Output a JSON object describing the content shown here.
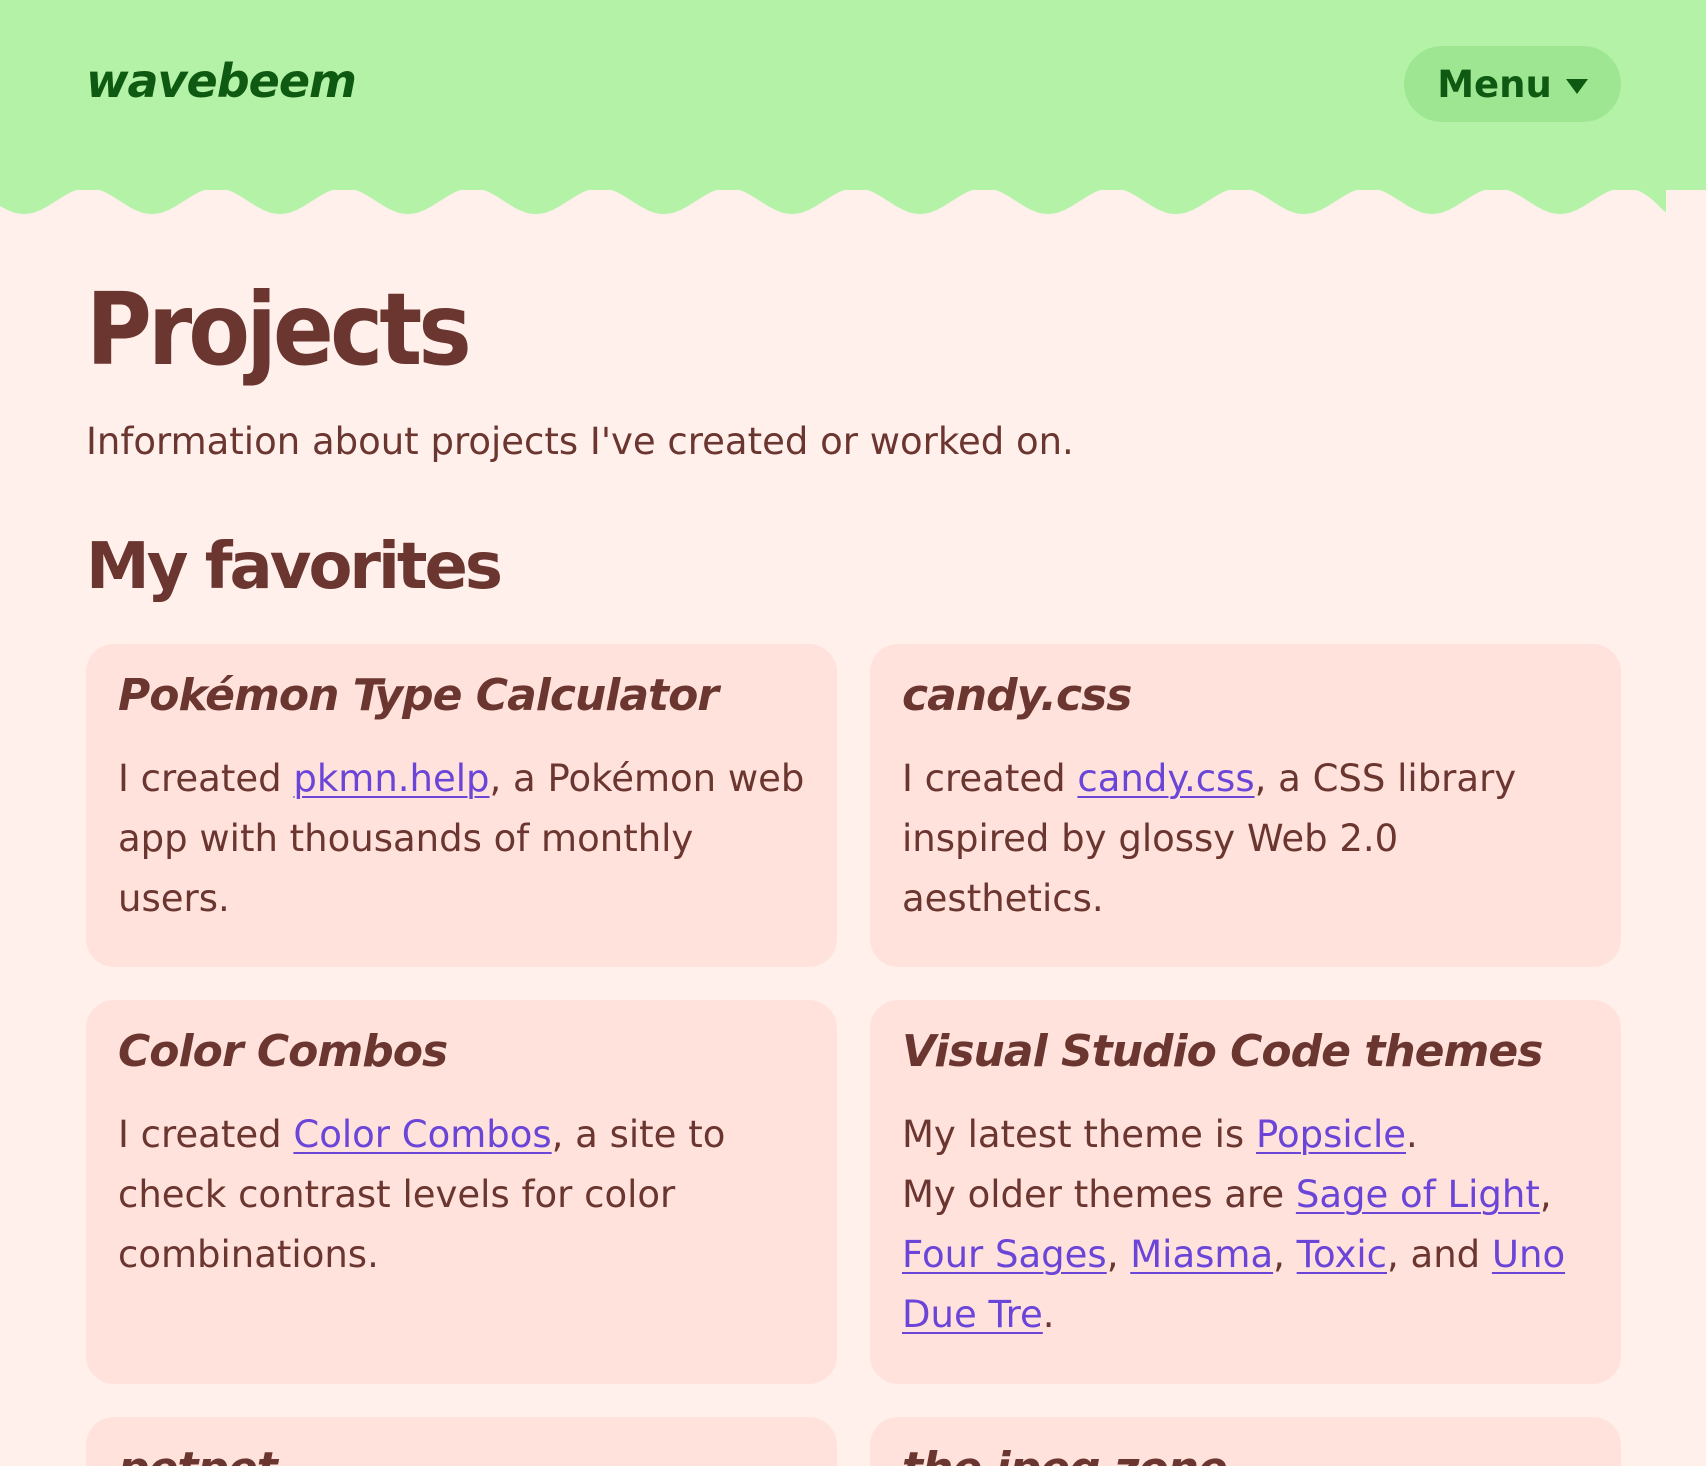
{
  "header": {
    "logo": "wavebeem",
    "menu_label": "Menu"
  },
  "page": {
    "title": "Projects",
    "intro": "Information about projects I've created or worked on.",
    "section_title": "My favorites"
  },
  "cards": [
    {
      "title": "Pokémon Type Calculator",
      "pre": "I created ",
      "link": "pkmn.help",
      "post": ", a Pokémon web app with thousands of monthly users."
    },
    {
      "title": "candy.css",
      "pre": "I created ",
      "link": "candy.css",
      "post": ", a CSS library inspired by glossy Web 2.0 aesthetics."
    },
    {
      "title": "Color Combos",
      "pre": "I created ",
      "link": "Color Combos",
      "post": ", a site to check contrast levels for color combinations."
    },
    {
      "title": "Visual Studio Code themes",
      "line1_pre": "My latest theme is ",
      "line1_link": "Popsicle",
      "line1_post": ".",
      "line2_pre": "My older themes are ",
      "links": [
        "Sage of Light",
        "Four Sages",
        "Miasma",
        "Toxic",
        "Uno Due Tre"
      ],
      "sep_comma": ", ",
      "sep_and": ", and ",
      "end": "."
    },
    {
      "title": "petpet"
    },
    {
      "title": "the jpeg zone"
    }
  ],
  "colors": {
    "header_bg": "#b3f2a7",
    "header_text": "#0f5a12",
    "menu_bg": "#9fe693",
    "page_bg": "#fff0eb",
    "card_bg": "#ffe2dc",
    "text": "#6b3530",
    "link": "#6a45d8"
  }
}
